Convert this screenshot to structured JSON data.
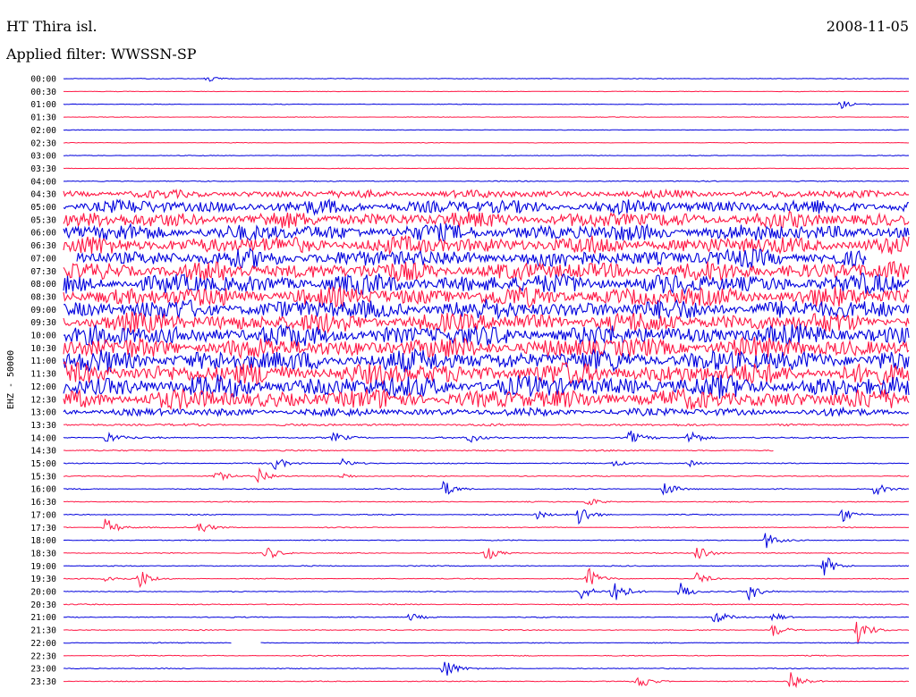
{
  "header": {
    "station": "HT Thira isl.",
    "date": "2008-11-05",
    "filter": "Applied filter: WWSSN-SP"
  },
  "chart_data": {
    "type": "helicorder",
    "ylabel": "EHZ - 50000",
    "trace_colors": [
      "#0000dd",
      "#ff1744"
    ],
    "rows": [
      "00:00",
      "00:30",
      "01:00",
      "01:30",
      "02:00",
      "02:30",
      "03:00",
      "03:30",
      "04:00",
      "04:30",
      "05:00",
      "05:30",
      "06:00",
      "06:30",
      "07:00",
      "07:30",
      "08:00",
      "08:30",
      "09:00",
      "09:30",
      "10:00",
      "10:30",
      "11:00",
      "11:30",
      "12:00",
      "12:30",
      "13:00",
      "13:30",
      "14:00",
      "14:30",
      "15:00",
      "15:30",
      "16:00",
      "16:30",
      "17:00",
      "17:30",
      "18:00",
      "18:30",
      "19:00",
      "19:30",
      "20:00",
      "20:30",
      "21:00",
      "21:30",
      "22:00",
      "22:30",
      "23:00",
      "23:30"
    ],
    "row_noise_level": [
      0.35,
      0.3,
      0.35,
      0.3,
      0.3,
      0.3,
      0.35,
      0.3,
      0.5,
      4,
      7,
      8,
      8.5,
      9,
      9,
      9.5,
      10,
      10,
      10,
      10,
      10.5,
      10.5,
      11,
      11,
      11,
      10,
      4,
      1.2,
      0.8,
      0.7,
      0.6,
      0.5,
      0.5,
      0.5,
      0.5,
      0.5,
      0.5,
      0.5,
      0.5,
      0.5,
      0.5,
      0.5,
      0.5,
      0.5,
      0.5,
      0.5,
      0.5,
      0.5
    ],
    "events": [
      {
        "row": 0,
        "t": 0.17,
        "amp": 4
      },
      {
        "row": 2,
        "t": 0.92,
        "amp": 5
      },
      {
        "row": 28,
        "t": 0.05,
        "amp": 8
      },
      {
        "row": 28,
        "t": 0.32,
        "amp": 6
      },
      {
        "row": 28,
        "t": 0.48,
        "amp": 6
      },
      {
        "row": 28,
        "t": 0.67,
        "amp": 8
      },
      {
        "row": 28,
        "t": 0.74,
        "amp": 12
      },
      {
        "row": 30,
        "t": 0.25,
        "amp": 8
      },
      {
        "row": 30,
        "t": 0.33,
        "amp": 5
      },
      {
        "row": 30,
        "t": 0.65,
        "amp": 4
      },
      {
        "row": 30,
        "t": 0.74,
        "amp": 4
      },
      {
        "row": 31,
        "t": 0.18,
        "amp": 7
      },
      {
        "row": 31,
        "t": 0.23,
        "amp": 12
      },
      {
        "row": 31,
        "t": 0.33,
        "amp": 4
      },
      {
        "row": 32,
        "t": 0.45,
        "amp": 10
      },
      {
        "row": 32,
        "t": 0.71,
        "amp": 10
      },
      {
        "row": 32,
        "t": 0.96,
        "amp": 8
      },
      {
        "row": 33,
        "t": 0.62,
        "amp": 6
      },
      {
        "row": 34,
        "t": 0.56,
        "amp": 5
      },
      {
        "row": 34,
        "t": 0.61,
        "amp": 14
      },
      {
        "row": 34,
        "t": 0.92,
        "amp": 9
      },
      {
        "row": 35,
        "t": 0.05,
        "amp": 12
      },
      {
        "row": 35,
        "t": 0.16,
        "amp": 9
      },
      {
        "row": 36,
        "t": 0.83,
        "amp": 11
      },
      {
        "row": 37,
        "t": 0.24,
        "amp": 9
      },
      {
        "row": 37,
        "t": 0.5,
        "amp": 9
      },
      {
        "row": 37,
        "t": 0.75,
        "amp": 12
      },
      {
        "row": 38,
        "t": 0.9,
        "amp": 13
      },
      {
        "row": 39,
        "t": 0.05,
        "amp": 6
      },
      {
        "row": 39,
        "t": 0.09,
        "amp": 12
      },
      {
        "row": 39,
        "t": 0.62,
        "amp": 14
      },
      {
        "row": 39,
        "t": 0.75,
        "amp": 8
      },
      {
        "row": 40,
        "t": 0.61,
        "amp": 12
      },
      {
        "row": 40,
        "t": 0.65,
        "amp": 9
      },
      {
        "row": 40,
        "t": 0.65,
        "amp": 12
      },
      {
        "row": 40,
        "t": 0.73,
        "amp": 11
      },
      {
        "row": 40,
        "t": 0.81,
        "amp": 11
      },
      {
        "row": 42,
        "t": 0.41,
        "amp": 5
      },
      {
        "row": 42,
        "t": 0.77,
        "amp": 10
      },
      {
        "row": 42,
        "t": 0.84,
        "amp": 6
      },
      {
        "row": 43,
        "t": 0.84,
        "amp": 8
      },
      {
        "row": 43,
        "t": 0.94,
        "amp": 16
      },
      {
        "row": 46,
        "t": 0.45,
        "amp": 14
      },
      {
        "row": 47,
        "t": 0.68,
        "amp": 11
      },
      {
        "row": 47,
        "t": 0.86,
        "amp": 14
      }
    ],
    "gaps": [
      {
        "row": 14,
        "from": 0.0,
        "to": 0.015
      },
      {
        "row": 14,
        "from": 0.95,
        "to": 1.0
      },
      {
        "row": 29,
        "from": 0.84,
        "to": 1.0
      },
      {
        "row": 44,
        "from": 0.2,
        "to": 0.232
      }
    ],
    "grid": false
  }
}
